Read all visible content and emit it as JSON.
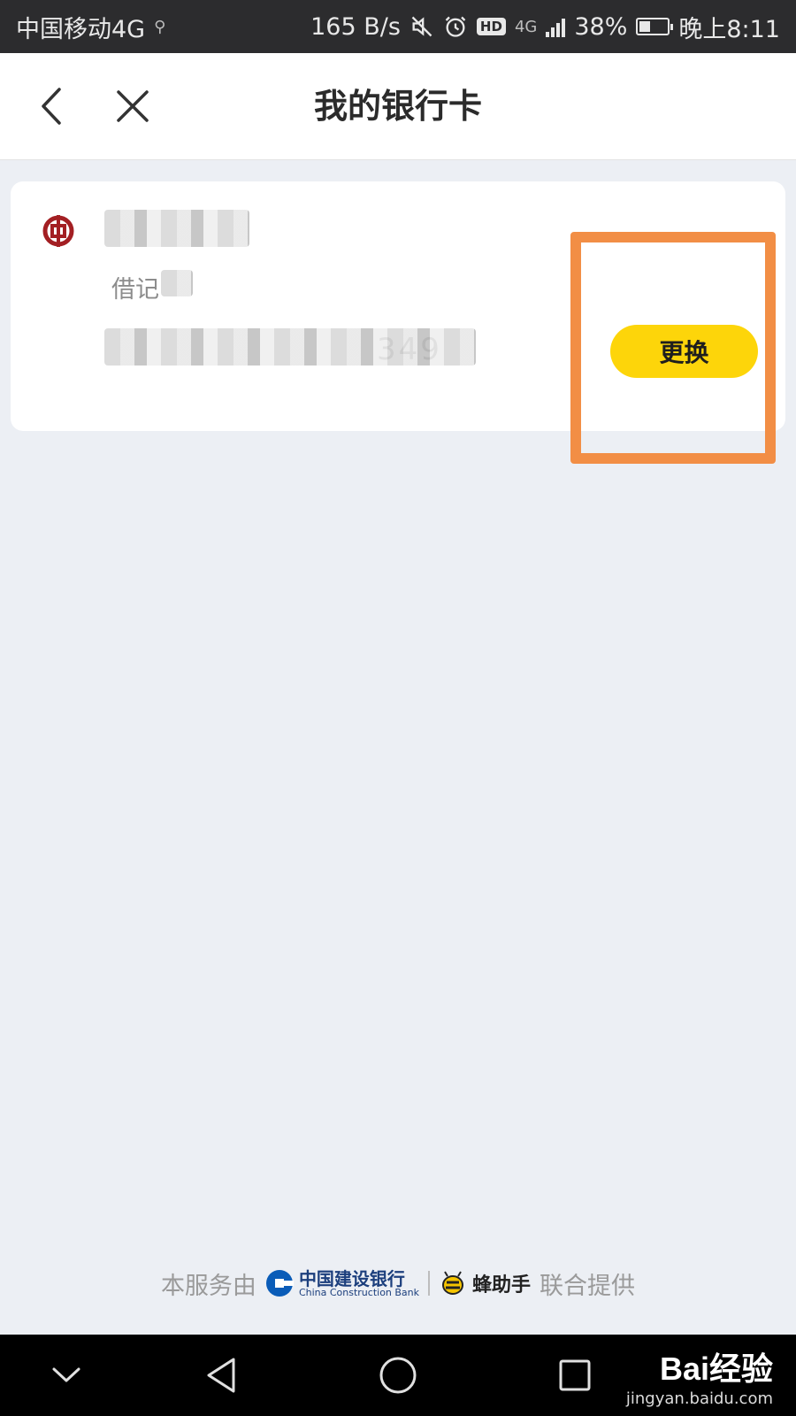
{
  "status_bar": {
    "carrier": "中国移动4G",
    "net_speed": "165 B/s",
    "network_type": "4G",
    "hd_label": "HD",
    "battery": "38%",
    "battery_level": 38,
    "time": "晚上8:11",
    "icons": [
      "mute-icon",
      "alarm-icon",
      "hd-icon",
      "signal-icon",
      "battery-icon"
    ]
  },
  "header": {
    "title": "我的银行卡",
    "icons": [
      "back-arrow-icon",
      "close-icon"
    ]
  },
  "card": {
    "bank_logo": "boc-logo-icon",
    "card_type_visible": "借记",
    "card_number_visible_tail": "349",
    "change_button_label": "更换",
    "accent_color": "#fdd50a",
    "highlight_color": "#f28e45"
  },
  "footer": {
    "prefix": "本服务由",
    "ccb_name": "中国建设银行",
    "ccb_english": "China Construction Bank",
    "partner_name": "蜂助手",
    "suffix": "联合提供"
  },
  "nav_bar": {
    "icons": [
      "chevron-down-icon",
      "back-triangle-icon",
      "home-circle-icon",
      "recents-square-icon"
    ]
  },
  "watermark": {
    "logo": "Bai经验",
    "url": "jingyan.baidu.com"
  }
}
